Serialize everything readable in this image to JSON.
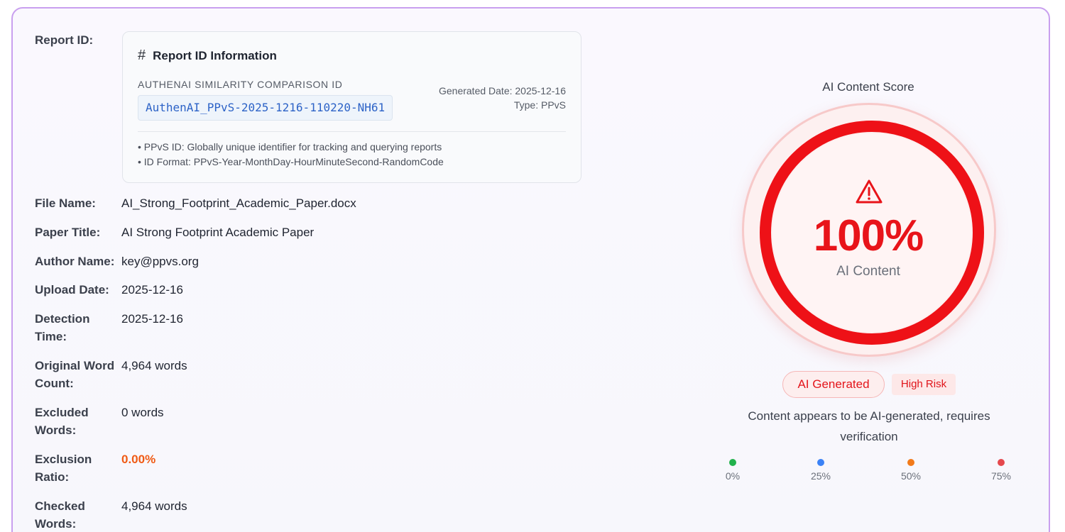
{
  "report_id": {
    "label": "Report ID:",
    "box_title": "Report ID Information",
    "caption": "AUTHENAI SIMILARITY COMPARISON ID",
    "code": "AuthenAI_PPvS-2025-1216-110220-NH61",
    "generated_date": "Generated Date: 2025-12-16",
    "type": "Type: PPvS",
    "notes": [
      "• PPvS ID: Globally unique identifier for tracking and querying reports",
      "• ID Format: PPvS-Year-MonthDay-HourMinuteSecond-RandomCode"
    ]
  },
  "fields": {
    "file_name": {
      "label": "File Name:",
      "value": "AI_Strong_Footprint_Academic_Paper.docx"
    },
    "paper_title": {
      "label": "Paper Title:",
      "value": "AI Strong Footprint Academic Paper"
    },
    "author_name": {
      "label": "Author Name:",
      "value": "key@ppvs.org"
    },
    "upload_date": {
      "label": "Upload Date:",
      "value": "2025-12-16"
    },
    "detection_time": {
      "label_line1": "Detection",
      "label_line2": "Time:",
      "value": "2025-12-16"
    },
    "original_word_count": {
      "label_line1": "Original Word",
      "label_line2": "Count:",
      "value": "4,964 words"
    },
    "excluded_words": {
      "label_line1": "Excluded",
      "label_line2": "Words:",
      "value": "0 words"
    },
    "exclusion_ratio": {
      "label_line1": "Exclusion",
      "label_line2": "Ratio:",
      "value": "0.00%"
    },
    "checked_words": {
      "label_line1": "Checked",
      "label_line2": "Words:",
      "value": "4,964 words"
    }
  },
  "score": {
    "title": "AI Content Score",
    "percent_text": "100%",
    "percent_value": 100,
    "subtitle": "AI Content",
    "badge": "AI Generated",
    "risk": "High Risk",
    "description": "Content appears to be AI-generated, requires verification",
    "scale": [
      {
        "label": "0%",
        "color": "#22b24c"
      },
      {
        "label": "25%",
        "color": "#3b82f6"
      },
      {
        "label": "50%",
        "color": "#f27a1a"
      },
      {
        "label": "75%",
        "color": "#e5484d"
      }
    ]
  },
  "colors": {
    "accent_red": "#e8141a",
    "card_border": "#c9a0ef",
    "id_code": "#2d63c7",
    "warning_orange": "#f05a14"
  },
  "icons": {
    "report_heading": "hash-icon",
    "score_alert": "warning-triangle-icon"
  }
}
